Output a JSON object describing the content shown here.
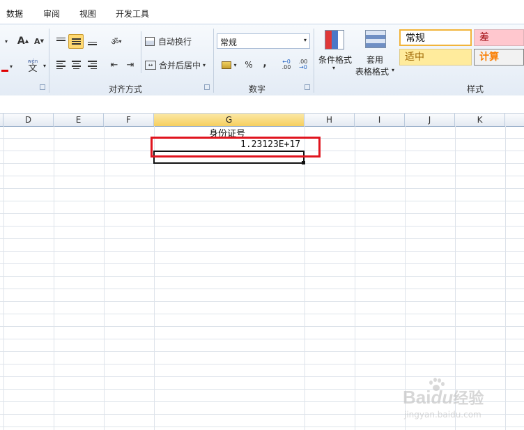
{
  "menu": {
    "items": [
      "数据",
      "审阅",
      "视图",
      "开发工具"
    ]
  },
  "ribbon": {
    "font": {
      "grow_label": "A",
      "shrink_label": "A",
      "phonetic_label": "wén",
      "phonetic_char": "文"
    },
    "alignment": {
      "group_label": "对齐方式",
      "wrap_text_label": "自动换行",
      "merge_center_label": "合并后居中"
    },
    "number": {
      "group_label": "数字",
      "format_value": "常规",
      "percent_label": "%",
      "comma_label": ",",
      "increase_decimal_label": ".00",
      "decrease_decimal_label": ".00"
    },
    "styles": {
      "group_label": "样式",
      "conditional_label": "条件格式",
      "table_line1": "套用",
      "table_line2": "表格格式",
      "cells": [
        {
          "label": "常规",
          "bg": "#ffffff",
          "fg": "#111111"
        },
        {
          "label": "差",
          "bg": "#ffc7ce",
          "fg": "#9c0006"
        },
        {
          "label": "适中",
          "bg": "#ffeb9c",
          "fg": "#9c6500"
        },
        {
          "label": "计算",
          "bg": "#f2f2f2",
          "fg": "#fa7d00"
        }
      ]
    }
  },
  "sheet": {
    "columns": [
      "D",
      "E",
      "F",
      "G",
      "H",
      "I",
      "J",
      "K"
    ],
    "selected_column": "G",
    "cells": {
      "g1": "身份证号",
      "g2": "1.23123E+17"
    }
  },
  "colors": {
    "highlight_box": "#e0141e",
    "selected_header": "#f6cf5e",
    "active_align_button": "#ffd971"
  },
  "watermark": {
    "brand": "Bai",
    "brand2": "du",
    "suffix": "经验",
    "url": "jingyan.baidu.com"
  }
}
